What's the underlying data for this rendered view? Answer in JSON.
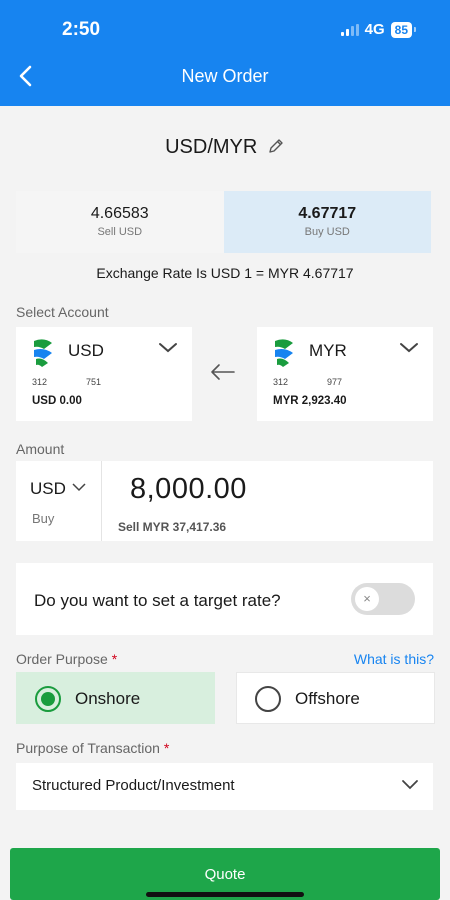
{
  "status_bar": {
    "time": "2:50",
    "network": "4G",
    "battery": "85"
  },
  "header": {
    "title": "New Order"
  },
  "pair": {
    "label": "USD/MYR"
  },
  "rates": {
    "sell": {
      "value": "4.66583",
      "label": "Sell USD"
    },
    "buy": {
      "value": "4.67717",
      "label": "Buy USD"
    }
  },
  "exchange_rate_text": "Exchange Rate Is USD 1 = MYR 4.67717",
  "select_account": {
    "label": "Select Account",
    "from": {
      "currency": "USD",
      "num1": "312",
      "num2": "751",
      "balance": "USD 0.00"
    },
    "to": {
      "currency": "MYR",
      "num1": "312",
      "num2": "977",
      "balance": "MYR 2,923.40"
    }
  },
  "amount": {
    "label": "Amount",
    "currency": "USD",
    "direction": "Buy",
    "value": "8,000.00",
    "sell_text": "Sell MYR 37,417.36"
  },
  "target_rate": {
    "question": "Do you want to set a target rate?",
    "enabled": false,
    "knob_icon": "×"
  },
  "order_purpose": {
    "label": "Order Purpose",
    "required_mark": "*",
    "help_link": "What is this?",
    "options": [
      {
        "label": "Onshore",
        "selected": true
      },
      {
        "label": "Offshore",
        "selected": false
      }
    ]
  },
  "purpose_of_transaction": {
    "label": "Purpose of Transaction",
    "required_mark": "*",
    "value": "Structured Product/Investment"
  },
  "quote_button": {
    "label": "Quote"
  },
  "colors": {
    "header": "#1784f0",
    "accent_green": "#1ea64a",
    "selected_bg": "#d8efde",
    "buy_bg": "#dcebf7",
    "link": "#1784f0"
  }
}
